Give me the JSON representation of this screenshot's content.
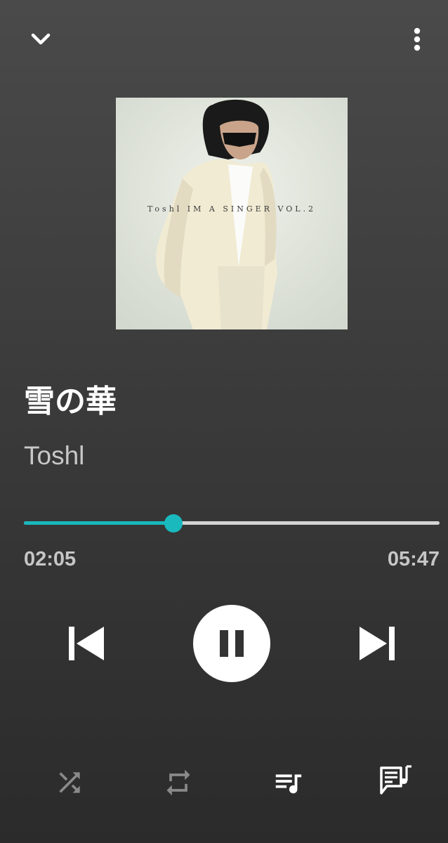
{
  "track": {
    "title": "雪の華",
    "artist": "Toshl",
    "album_cover_text": "Toshl  IM A SINGER VOL.2"
  },
  "playback": {
    "elapsed": "02:05",
    "total": "05:47",
    "progress_fraction": 0.36,
    "state": "playing"
  },
  "colors": {
    "accent": "#19b9be",
    "track_inactive": "#d4d4d4",
    "icon_active": "#ffffff",
    "icon_inactive": "#8a8a8a"
  },
  "icons": {
    "collapse": "chevron-down-icon",
    "more": "more-vertical-icon",
    "previous": "skip-previous-icon",
    "pause": "pause-icon",
    "next": "skip-next-icon",
    "shuffle": "shuffle-icon",
    "repeat": "repeat-icon",
    "queue": "queue-music-icon",
    "lyrics": "lyrics-icon"
  },
  "modes": {
    "shuffle_on": false,
    "repeat_on": false
  }
}
